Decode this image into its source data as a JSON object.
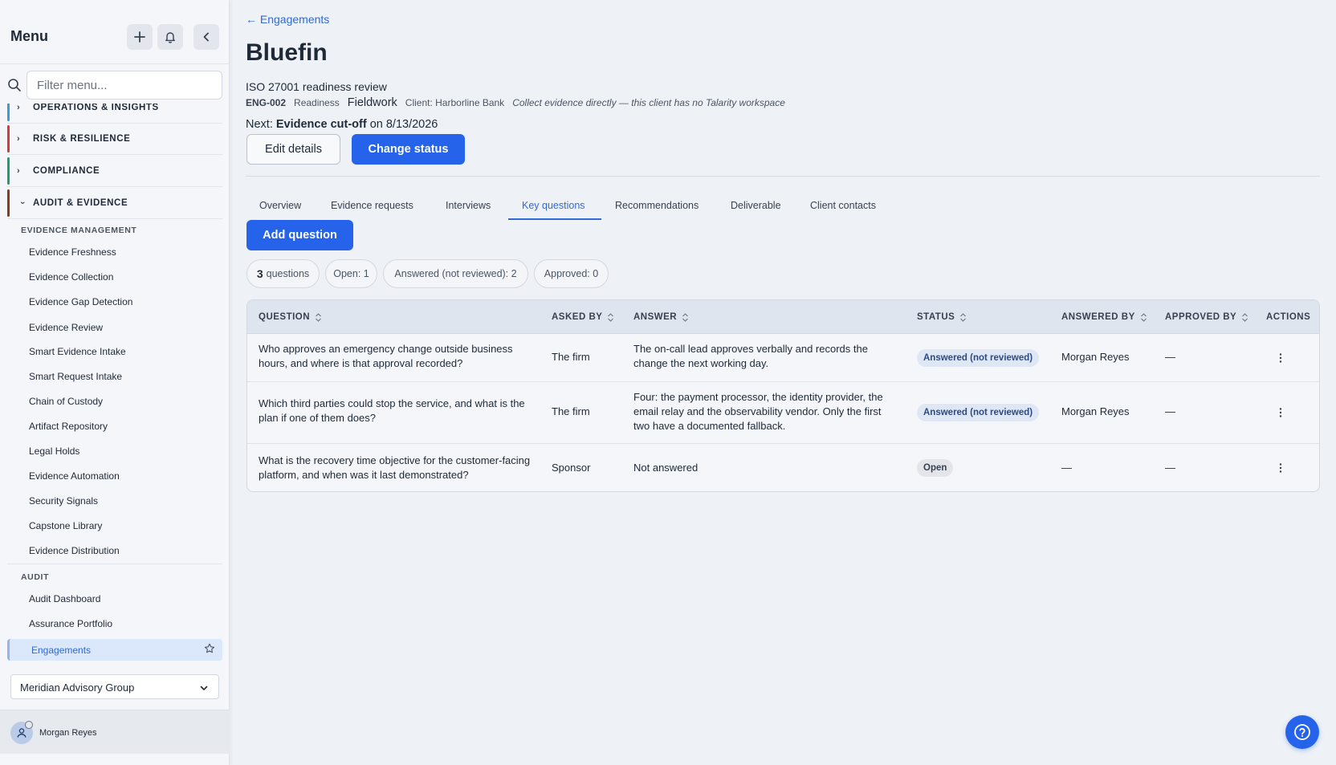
{
  "sidebar": {
    "title": "Menu",
    "filter_placeholder": "Filter menu...",
    "sections": [
      {
        "label": "OPERATIONS & INSIGHTS",
        "color": "#3b9ad9",
        "expanded": false
      },
      {
        "label": "RISK & RESILIENCE",
        "color": "#d9383b",
        "expanded": false
      },
      {
        "label": "COMPLIANCE",
        "color": "#1f9d6b",
        "expanded": false
      },
      {
        "label": "AUDIT & EVIDENCE",
        "color": "#8b3a1a",
        "expanded": true
      }
    ],
    "evidence_group": {
      "label": "EVIDENCE MANAGEMENT",
      "items": [
        "Evidence Freshness",
        "Evidence Collection",
        "Evidence Gap Detection",
        "Evidence Review",
        "Smart Evidence Intake",
        "Smart Request Intake",
        "Chain of Custody",
        "Artifact Repository",
        "Legal Holds",
        "Evidence Automation",
        "Security Signals",
        "Capstone Library",
        "Evidence Distribution"
      ]
    },
    "audit_group": {
      "label": "AUDIT",
      "items": [
        "Audit Dashboard",
        "Assurance Portfolio"
      ],
      "active_item": "Engagements"
    },
    "org": "Meridian Advisory Group",
    "user": "Morgan Reyes"
  },
  "main": {
    "back_link": "← Engagements",
    "title": "Bluefin",
    "subtitle": "ISO 27001 readiness review",
    "code": "ENG-002",
    "type": "Readiness",
    "phase": "Fieldwork",
    "client": "Client: Harborline Bank",
    "note": "Collect evidence directly — this client has no Talarity workspace",
    "next_prefix": "Next:",
    "next_event": "Evidence cut-off",
    "next_suffix": "on 8/13/2026",
    "edit_button": "Edit details",
    "status_button": "Change status",
    "tabs": [
      "Overview",
      "Evidence requests",
      "Interviews",
      "Key questions",
      "Recommendations",
      "Deliverable",
      "Client contacts"
    ],
    "active_tab": "Key questions",
    "add_button": "Add question",
    "chips": {
      "count": "3",
      "count_label": "questions",
      "open": "Open: 1",
      "answered": "Answered (not reviewed): 2",
      "approved": "Approved: 0"
    },
    "table": {
      "headers": [
        "QUESTION",
        "ASKED BY",
        "ANSWER",
        "STATUS",
        "ANSWERED BY",
        "APPROVED BY",
        "ACTIONS"
      ],
      "rows": [
        {
          "question": "Who approves an emergency change outside business hours, and where is that approval recorded?",
          "asked_by": "The firm",
          "answer": "The on-call lead approves verbally and records the change the next working day.",
          "status": "Answered (not reviewed)",
          "answered_by": "Morgan Reyes",
          "approved_by": "—"
        },
        {
          "question": "Which third parties could stop the service, and what is the plan if one of them does?",
          "asked_by": "The firm",
          "answer": "Four: the payment processor, the identity provider, the email relay and the observability vendor. Only the first two have a documented fallback.",
          "status": "Answered (not reviewed)",
          "answered_by": "Morgan Reyes",
          "approved_by": "—"
        },
        {
          "question": "What is the recovery time objective for the customer-facing platform, and when was it last demonstrated?",
          "asked_by": "Sponsor",
          "answer": "Not answered",
          "status": "Open",
          "answered_by": "—",
          "approved_by": "—"
        }
      ]
    }
  },
  "icons": {
    "add": "plus-icon",
    "notifications": "bell-icon",
    "collapse": "chevron-left-icon",
    "search": "search-icon",
    "favorite": "star-icon",
    "dropdown": "chevron-down-icon",
    "user": "user-icon",
    "sort": "sort-icon",
    "row_actions": "kebab-icon",
    "help": "help-icon"
  },
  "colors": {
    "accent": "#2563eb",
    "link": "#2f6ad8"
  }
}
